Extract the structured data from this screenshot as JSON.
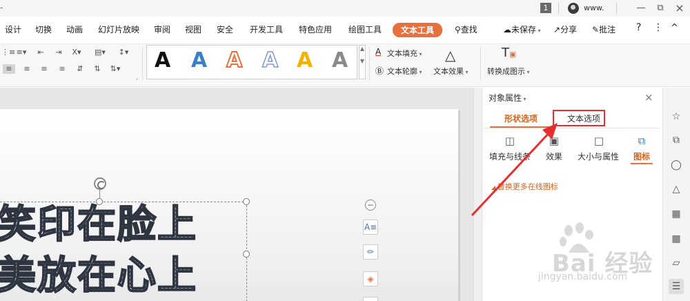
{
  "titlebar": {
    "page_number": "1",
    "username": "www.",
    "minimize_label": "—",
    "restore_label": "⧉",
    "close_label": "×"
  },
  "menubar": {
    "items": [
      "设计",
      "切换",
      "动画",
      "幻灯片放映",
      "审阅",
      "视图",
      "安全",
      "开发工具",
      "特色应用",
      "绘图工具",
      "文本工具"
    ],
    "active_tab": "文本工具",
    "search_label": "查找",
    "unsaved_label": "未保存",
    "share_label": "分享",
    "comment_label": "批注",
    "help_label": "?",
    "more_label": "⋮",
    "collapse_label": "^"
  },
  "ribbon": {
    "text_fill_label": "文本填充",
    "text_outline_label": "文本轮廓",
    "text_effects_label": "文本效果",
    "convert_label": "转换成图示",
    "style_gallery_letter": "A",
    "gallery_colors": [
      "#111111",
      "#3b7fc4",
      "#e8703d",
      "#7d9cc8",
      "#f2b400",
      "#777777"
    ]
  },
  "document": {
    "line1": "笑印在脸上",
    "line2": "美放在心上"
  },
  "panel": {
    "title": "对象属性",
    "tab_shape": "形状选项",
    "tab_text": "文本选项",
    "sub_fill": "填充与线条",
    "sub_effect": "效果",
    "sub_size": "大小与属性",
    "sub_icon": "图标",
    "more_icons_label": "替换更多在线图标",
    "close_label": "×"
  },
  "watermark": {
    "brand": "Bai 经验",
    "url": "jingyan.baidu.com"
  },
  "colors": {
    "accent": "#e8703d",
    "highlight_box": "#e62e2e"
  }
}
